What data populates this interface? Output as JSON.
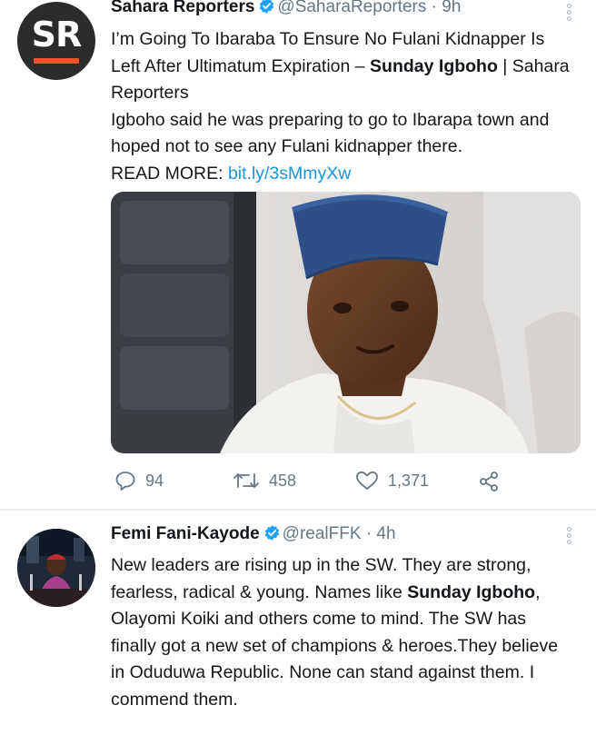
{
  "tweets": [
    {
      "avatar_text": "SR",
      "name": "Sahara Reporters",
      "handle": "@SaharaReporters",
      "separator": "·",
      "time": "9h",
      "headline_part1": "I’m Going To Ibaraba To Ensure No Fulani Kidnapper Is Left After Ultimatum Expiration – ",
      "headline_bold": "Sunday Igboho",
      "headline_part2": " | Sahara Reporters",
      "summary": "Igboho said he was preparing to go to Ibarapa town and hoped not to see any Fulani kidnapper there.",
      "read_more_label": "READ MORE: ",
      "link": "bit.ly/3sMmyXw",
      "replies": "94",
      "retweets": "458",
      "likes": "1,371"
    },
    {
      "name": "Femi Fani-Kayode",
      "handle": "@realFFK",
      "separator": "·",
      "time": "4h",
      "body_part1": "New leaders are rising up in the SW. They are strong, fearless, radical & young. Names like ",
      "body_bold": "Sunday Igboho",
      "body_part2": ", Olayomi Koiki and others come to mind. The SW has finally got a new set of champions & heroes.They believe in Oduduwa Republic. None can stand against them. I commend them."
    }
  ],
  "colors": {
    "verified": "#1da1f2",
    "link": "#1b95e0",
    "secondary_text": "#657786",
    "sr_accent": "#e8542b"
  },
  "icons": [
    "verified-badge-icon",
    "more-options-icon",
    "reply-icon",
    "retweet-icon",
    "like-icon",
    "share-icon"
  ]
}
